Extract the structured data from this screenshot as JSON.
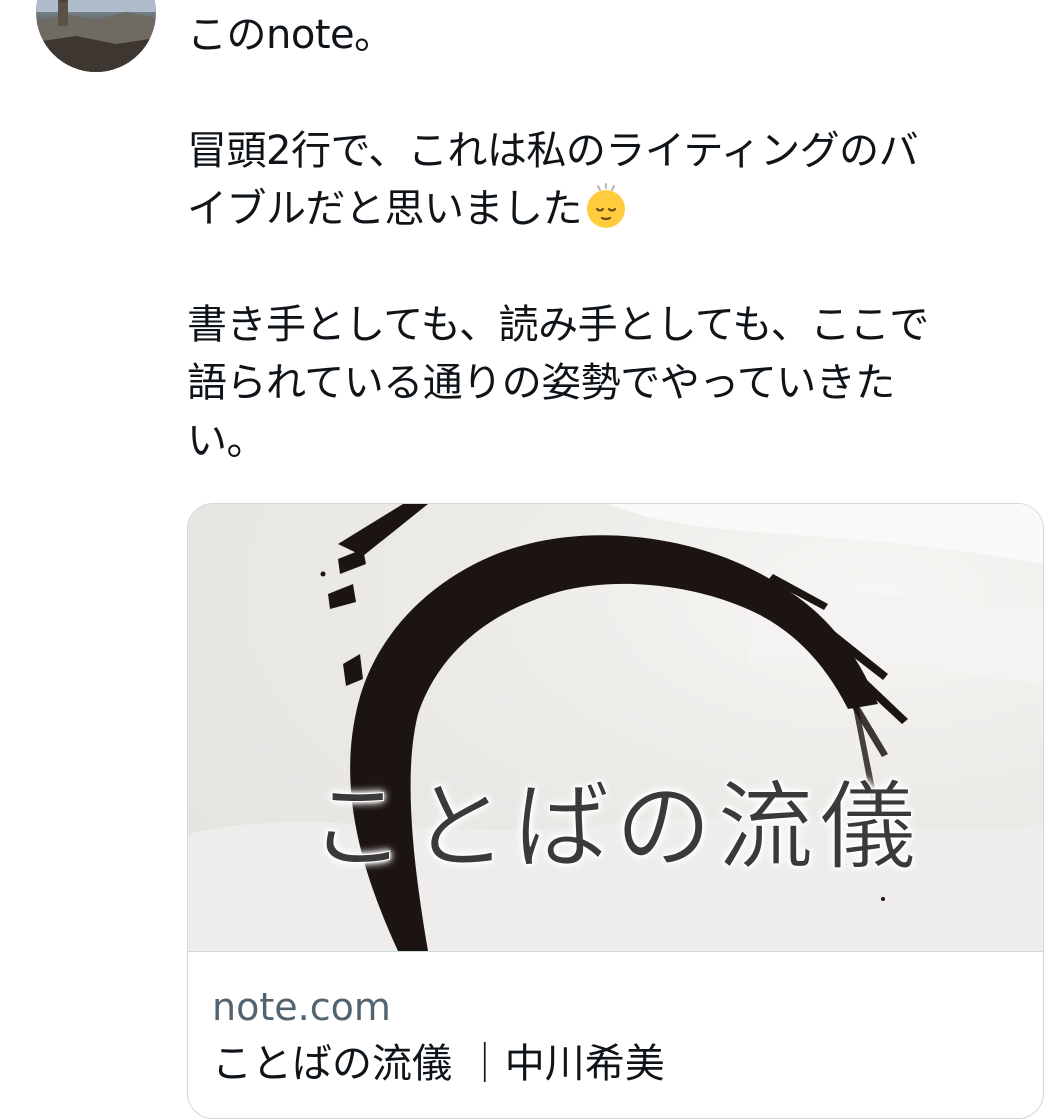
{
  "tweet": {
    "line1": "このnote。",
    "line2": "冒頭2行で、これは私のライティングのバ",
    "line3": "イブルだと思いました",
    "emoji": "relieved-face-emoji",
    "line4": "書き手としても、読み手としても、ここで",
    "line5": "語られている通りの姿勢でやっていきた",
    "line6": "い。"
  },
  "card": {
    "image_title": "ことばの流儀",
    "domain": "note.com",
    "title": "ことばの流儀 ｜中川希美"
  },
  "colors": {
    "text": "#0f1419",
    "secondary_text": "#536471",
    "card_border": "#cfd9de",
    "brush_stroke": "#1c1412"
  }
}
